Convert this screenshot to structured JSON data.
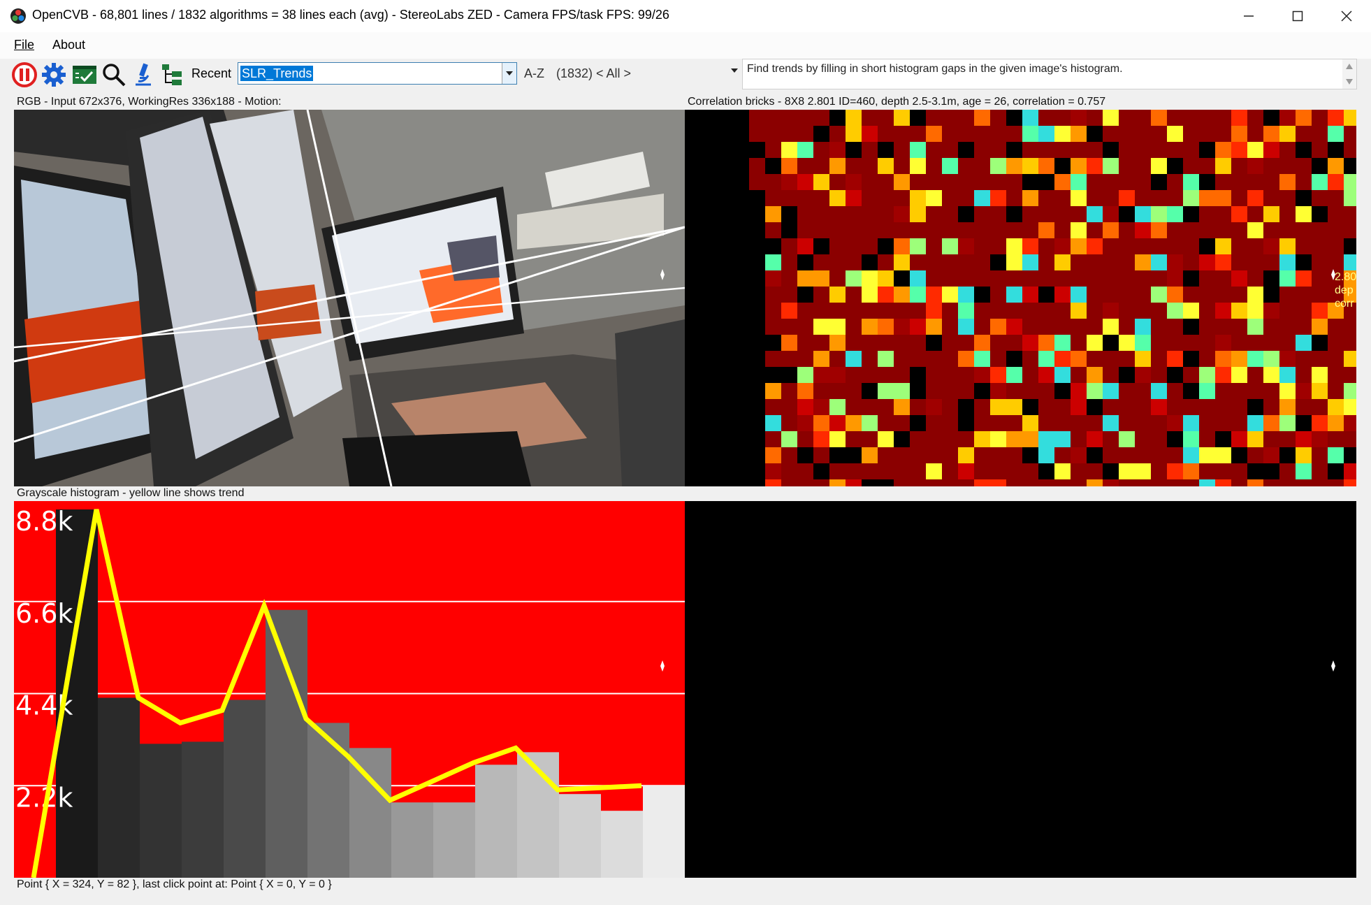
{
  "window": {
    "title": "OpenCVB - 68,801 lines / 1832 algorithms = 38 lines each (avg) - StereoLabs ZED - Camera FPS/task FPS: 99/26",
    "minimize_icon": "minimize-icon",
    "maximize_icon": "maximize-icon",
    "close_icon": "close-icon"
  },
  "menu": {
    "items": [
      {
        "label": "File"
      },
      {
        "label": "About"
      }
    ]
  },
  "toolbar": {
    "icons": [
      "pause-icon",
      "gear-icon",
      "checklist-icon",
      "search-icon",
      "microscope-icon",
      "tree-icon"
    ],
    "recent_label": "Recent",
    "algorithm_value": "SLR_Trends",
    "az_label": "A-Z",
    "group_value": "(1832) < All >",
    "description": "Find trends by filling in short histogram gaps in the given image's histogram."
  },
  "panels": {
    "rgb_label": "RGB - Input 672x376, WorkingRes 336x188 - Motion:",
    "corr_label": "Correlation bricks - 8X8  2.801 ID=460, depth 2.5-3.1m, age = 26, correlation = 0.757",
    "hist_label": "Grayscale histogram - yellow line shows trend",
    "corr_overlay": [
      "2.80",
      "dep",
      "corr"
    ]
  },
  "chart_data": {
    "type": "bar",
    "title": "Grayscale histogram - yellow line shows trend",
    "tick_labels": [
      "8.8k",
      "6.6k",
      "4.4k",
      "2.2k"
    ],
    "ylim": [
      0,
      8800
    ],
    "grid": true,
    "bin_grays": [
      "#1a1a1a",
      "#2a2a2a",
      "#333333",
      "#3c3c3c",
      "#4a4a4a",
      "#5f5f5f",
      "#737373",
      "#888888",
      "#999999",
      "#a8a8a8",
      "#b8b8b8",
      "#c4c4c4",
      "#d0d0d0",
      "#dcdcdc",
      "#ececec"
    ],
    "series": [
      {
        "values": [
          8800,
          4300,
          3200,
          3250,
          4250,
          6400,
          3700,
          3100,
          1800,
          1800,
          2700,
          3000,
          2000,
          1600,
          2200
        ]
      },
      {
        "values": [
          0,
          8800,
          4300,
          3700,
          4000,
          6500,
          3800,
          2900,
          1850,
          2300,
          2750,
          3100,
          2100,
          2150,
          2200
        ]
      }
    ],
    "colors": {
      "background": "#ff0000",
      "trend": "#ffff00",
      "gridline": "#ffffff"
    }
  },
  "status": {
    "text": "Point { X = 324, Y = 82 }, last click point at: Point { X = 0, Y = 0 }"
  }
}
